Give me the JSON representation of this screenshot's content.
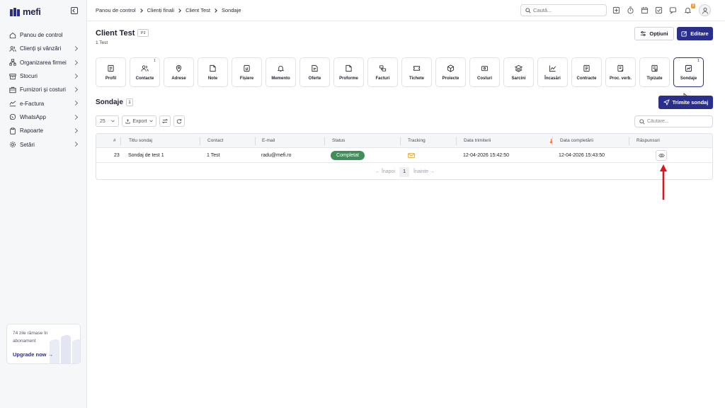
{
  "app": {
    "logo_text": "mefi"
  },
  "sidebar": {
    "items": [
      {
        "label": "Panou de control",
        "icon": "home-icon",
        "chevron": false
      },
      {
        "label": "Clienți și vânzări",
        "icon": "users-icon",
        "chevron": true
      },
      {
        "label": "Organizarea firmei",
        "icon": "org-icon",
        "chevron": true
      },
      {
        "label": "Stocuri",
        "icon": "box-icon",
        "chevron": true
      },
      {
        "label": "Furnizori și costuri",
        "icon": "supplier-icon",
        "chevron": true
      },
      {
        "label": "e-Factura",
        "icon": "efactura-icon",
        "chevron": true
      },
      {
        "label": "WhatsApp",
        "icon": "whatsapp-icon",
        "chevron": true
      },
      {
        "label": "Rapoarte",
        "icon": "report-icon",
        "chevron": true
      },
      {
        "label": "Setări",
        "icon": "gear-icon",
        "chevron": true
      }
    ],
    "upgrade": {
      "text": "74 zile rămase în abonament",
      "link": "Upgrade now"
    }
  },
  "topbar": {
    "breadcrumb": [
      "Panou de control",
      "Clienți finali",
      "Client Test",
      "Sondaje"
    ],
    "search_placeholder": "Caută...",
    "notif_count": "9"
  },
  "header": {
    "title": "Client Test",
    "badge": "PJ",
    "subtitle": "1 Test",
    "options_label": "Opțiuni",
    "edit_label": "Editare"
  },
  "tabs": [
    {
      "label": "Profil",
      "icon": "profile-icon",
      "count": ""
    },
    {
      "label": "Contacte",
      "icon": "contacts-icon",
      "count": "1"
    },
    {
      "label": "Adrese",
      "icon": "map-pin-icon",
      "count": ""
    },
    {
      "label": "Note",
      "icon": "note-icon",
      "count": ""
    },
    {
      "label": "Fișiere",
      "icon": "file-icon",
      "count": ""
    },
    {
      "label": "Memento",
      "icon": "bell-icon",
      "count": ""
    },
    {
      "label": "Oferte",
      "icon": "offer-icon",
      "count": ""
    },
    {
      "label": "Proforme",
      "icon": "proforma-icon",
      "count": ""
    },
    {
      "label": "Facturi",
      "icon": "invoice-icon",
      "count": ""
    },
    {
      "label": "Tichete",
      "icon": "ticket-icon",
      "count": ""
    },
    {
      "label": "Proiecte",
      "icon": "cube-icon",
      "count": ""
    },
    {
      "label": "Costuri",
      "icon": "cost-icon",
      "count": ""
    },
    {
      "label": "Sarcini",
      "icon": "layers-icon",
      "count": ""
    },
    {
      "label": "Încasări",
      "icon": "chart-line-icon",
      "count": ""
    },
    {
      "label": "Contracte",
      "icon": "contract-icon",
      "count": ""
    },
    {
      "label": "Proc. verb.",
      "icon": "minutes-icon",
      "count": ""
    },
    {
      "label": "Tipizate",
      "icon": "forms-icon",
      "count": ""
    },
    {
      "label": "Sondaje",
      "icon": "survey-icon",
      "count": "1",
      "active": true
    }
  ],
  "section": {
    "title": "Sondaje",
    "count": "1",
    "send_label": "Trimite sondaj",
    "page_size": "25",
    "export_label": "Export",
    "search_placeholder": "Căutare..."
  },
  "table": {
    "columns": [
      "#",
      "Titlu sondaj",
      "Contact",
      "E-mail",
      "Status",
      "Tracking",
      "Data trimiterii",
      "Data completării",
      "Răspunsuri"
    ],
    "rows": [
      {
        "id": "23",
        "title": "Sondaj de test 1",
        "contact": "1 Test",
        "email": "radu@mefi.ro",
        "status": "Completat",
        "sent": "12-04-2026 15:42:50",
        "completed": "12-04-2026 15:43:50"
      }
    ],
    "pagination": {
      "prev": "Înapoi",
      "page": "1",
      "next": "Înainte"
    }
  },
  "colors": {
    "brand": "#2b2f8c",
    "status_completed": "#3f8f58",
    "annotation": "#e0141e"
  }
}
